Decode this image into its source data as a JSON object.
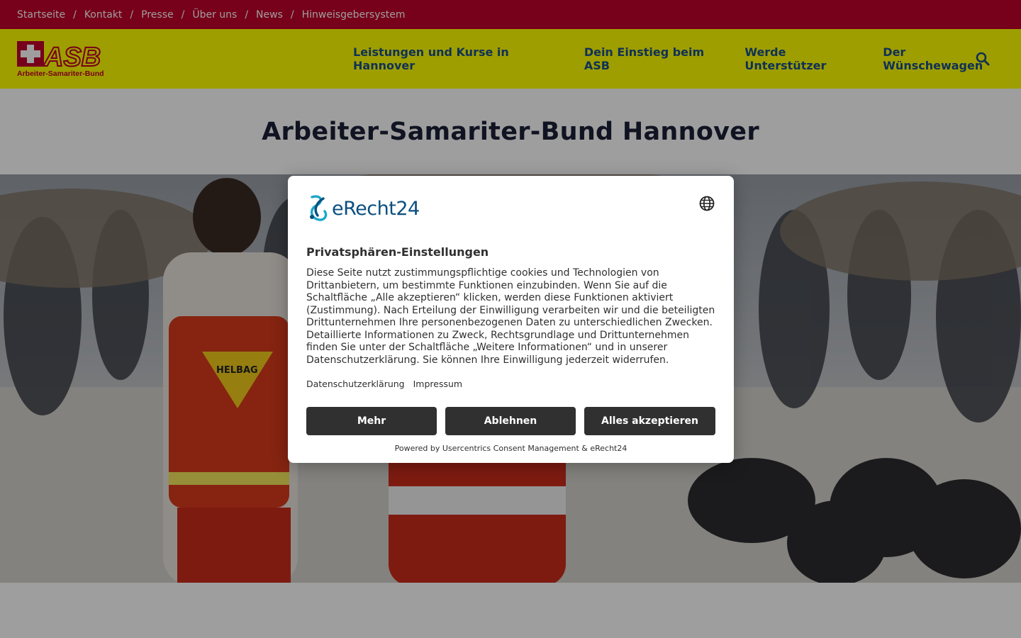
{
  "topbar": {
    "links": [
      "Startseite",
      "Kontakt",
      "Presse",
      "Über uns",
      "News",
      "Hinweisgebersystem"
    ],
    "separator": "/"
  },
  "header": {
    "logo": {
      "acronym": "ASB",
      "subtitle": "Arbeiter-Samariter-Bund"
    },
    "nav": [
      "Leistungen und Kurse in Hannover",
      "Dein Einstieg beim ASB",
      "Werde Unterstützer",
      "Der Wünschewagen"
    ],
    "search_icon": "search-icon"
  },
  "page": {
    "title": "Arbeiter-Samariter-Bund Hannover",
    "hero_bag_label": "HELBAG"
  },
  "consent": {
    "brand": "eRecht24",
    "language_icon": "globe-icon",
    "title": "Privatsphären-Einstellungen",
    "text": "Diese Seite nutzt zustimmungspflichtige cookies und Technologien von Drittanbietern, um bestimmte Funktionen einzubinden. Wenn Sie auf die Schaltfläche „Alle akzeptieren“ klicken, werden diese Funktionen aktiviert (Zustimmung). Nach Erteilung der Einwilligung verarbeiten wir und die beteiligten Drittunternehmen Ihre personenbezogenen Daten zu unterschiedlichen Zwecken. Detaillierte Informationen zu Zweck, Rechtsgrundlage und Drittunternehmen finden Sie unter der Schaltfläche „Weitere Informationen“ und in unserer Datenschutzerklärung. Sie können Ihre Einwilligung jederzeit widerrufen.",
    "links": [
      "Datenschutzerklärung",
      "Impressum"
    ],
    "buttons": {
      "more": "Mehr",
      "deny": "Ablehnen",
      "accept": "Alles akzeptieren"
    },
    "powered_by": "Powered by Usercentrics Consent Management & eRecht24"
  },
  "colors": {
    "topbar": "#c1002a",
    "header": "#ffff00",
    "nav_text": "#1a4f8b",
    "button_dark": "#303030",
    "brand_blue": "#0a4f7f"
  }
}
